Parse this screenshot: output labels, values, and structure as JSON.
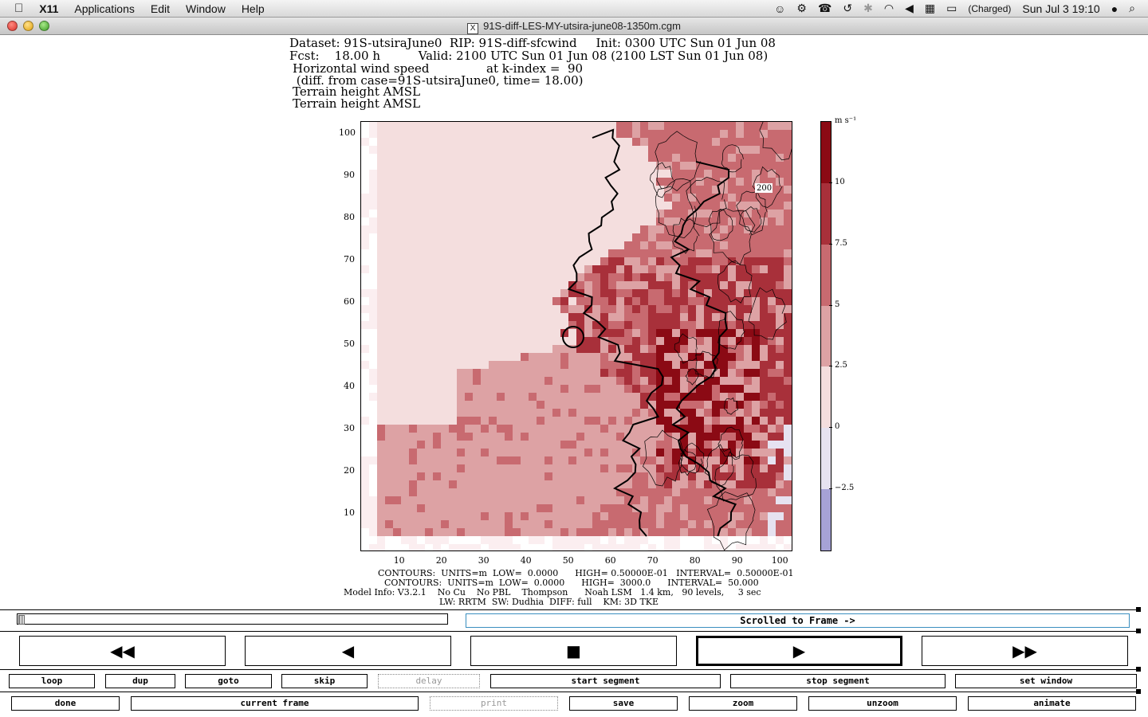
{
  "menubar": {
    "apple": "",
    "app_name": "X11",
    "menus": [
      "Applications",
      "Edit",
      "Window",
      "Help"
    ],
    "battery": "(Charged)",
    "clock": "Sun Jul 3  19:10"
  },
  "window": {
    "title": "91S-diff-LES-MY-utsira-june08-1350m.cgm"
  },
  "plot_header": {
    "line1": "Dataset: 91S-utsiraJune0  RIP: 91S-diff-sfcwind     Init: 0300 UTC Sun 01 Jun 08",
    "line2": "Fcst:    18.00 h          Valid: 2100 UTC Sun 01 Jun 08 (2100 LST Sun 01 Jun 08)",
    "line3": "Horizontal wind speed               at k-index =  90",
    "line4": " (diff. from case=91S-utsiraJune0, time= 18.00)",
    "line5": "Terrain height AMSL",
    "line6": "Terrain height AMSL"
  },
  "plot_footer": {
    "line1": "CONTOURS:  UNITS=m  LOW=  0.0000      HIGH= 0.50000E-01   INTERVAL=  0.50000E-01",
    "line2": "CONTOURS:  UNITS=m  LOW=  0.0000      HIGH=  3000.0      INTERVAL=  50.000",
    "line3": "Model Info: V3.2.1    No Cu    No PBL    Thompson      Noah LSM   1.4 km,   90 levels,     3 sec",
    "line4": "LW: RRTM  SW: Dudhia  DIFF: full    KM: 3D TKE"
  },
  "chart_data": {
    "type": "heatmap",
    "x_ticks": [
      "10",
      "20",
      "30",
      "40",
      "50",
      "60",
      "70",
      "80",
      "90",
      "100"
    ],
    "y_ticks": [
      "100",
      "90",
      "80",
      "70",
      "60",
      "50",
      "40",
      "30",
      "20",
      "10"
    ],
    "colorbar": {
      "unit": "m s⁻¹",
      "labels": [
        "10",
        "7.5",
        "5",
        "2.5",
        "0",
        "−2.5"
      ],
      "colors": [
        "#8b0a14",
        "#a8303a",
        "#c86a70",
        "#dda2a4",
        "#f4dede",
        "#e6e2f0",
        "#a6a2d6"
      ]
    },
    "contour_label": "200"
  },
  "controls": {
    "scroll_status": "Scrolled to Frame ->",
    "big_buttons": [
      "◀◀",
      "◀",
      "■",
      "▶",
      "▶▶"
    ],
    "row1": [
      "loop",
      "dup",
      "goto",
      "skip",
      "delay",
      "start segment",
      "stop segment",
      "set window"
    ],
    "row2": [
      "done",
      "current frame",
      "print",
      "save",
      "zoom",
      "unzoom",
      "animate"
    ]
  }
}
